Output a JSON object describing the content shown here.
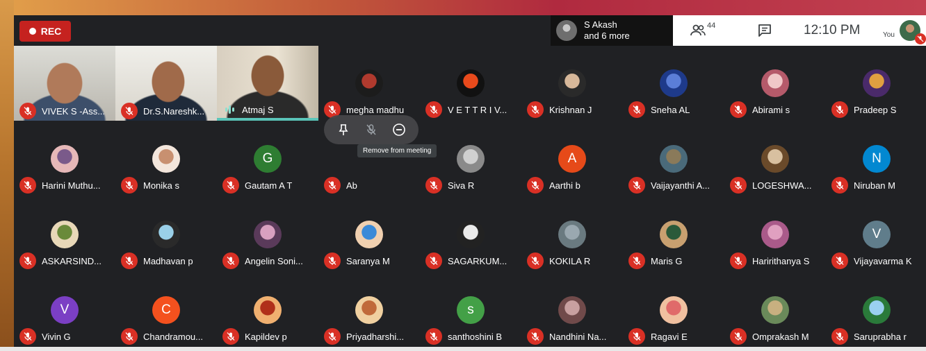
{
  "window": {
    "rec_label": "REC",
    "presenter": {
      "name": "S Akash",
      "more": "and 6 more"
    },
    "people_count": "44",
    "clock": "12:10 PM",
    "you_label": "You"
  },
  "hover": {
    "tooltip": "Remove from meeting"
  },
  "colors": {
    "mic_off": "#d93025",
    "rec": "#c5221f",
    "speaking": "#5ac4b8",
    "meet_bg": "#202124"
  },
  "participants": [
    {
      "name": "VIVEK S -Ass...",
      "muted": true,
      "video": true
    },
    {
      "name": "Dr.S.Nareshk...",
      "muted": true,
      "video": true
    },
    {
      "name": "Atmaj S",
      "muted": false,
      "speaking": true,
      "video": true
    },
    {
      "name": "megha madhu",
      "muted": true
    },
    {
      "name": "V E T T R I V...",
      "muted": true
    },
    {
      "name": "Krishnan J",
      "muted": true
    },
    {
      "name": "Sneha AL",
      "muted": true
    },
    {
      "name": "Abirami s",
      "muted": true
    },
    {
      "name": "Pradeep S",
      "muted": true
    },
    {
      "name": "Harini Muthu...",
      "muted": true
    },
    {
      "name": "Monika s",
      "muted": true
    },
    {
      "name": "Gautam A T",
      "muted": true,
      "letter": "G",
      "color": "#2e7d32"
    },
    {
      "name": "Ab",
      "muted": true
    },
    {
      "name": "Siva R",
      "muted": true
    },
    {
      "name": "Aarthi b",
      "muted": true,
      "letter": "A",
      "color": "#e64a19"
    },
    {
      "name": "Vaijayanthi A...",
      "muted": true
    },
    {
      "name": "LOGESHWA...",
      "muted": true
    },
    {
      "name": "Niruban M",
      "muted": true,
      "letter": "N",
      "color": "#0288d1"
    },
    {
      "name": "ASKARSIND...",
      "muted": true
    },
    {
      "name": "Madhavan p",
      "muted": true
    },
    {
      "name": "Angelin Soni...",
      "muted": true
    },
    {
      "name": "Saranya M",
      "muted": true
    },
    {
      "name": "SAGARKUM...",
      "muted": true
    },
    {
      "name": "KOKILA R",
      "muted": true
    },
    {
      "name": "Maris G",
      "muted": true
    },
    {
      "name": "Haririthanya S",
      "muted": true
    },
    {
      "name": "Vijayavarma K",
      "muted": true,
      "letter": "V",
      "color": "#607d8b"
    },
    {
      "name": "Vivin G",
      "muted": true,
      "letter": "V",
      "color": "#7b3fc4"
    },
    {
      "name": "Chandramou...",
      "muted": true,
      "letter": "C",
      "color": "#f4511e"
    },
    {
      "name": "Kapildev p",
      "muted": true
    },
    {
      "name": "Priyadharshi...",
      "muted": true
    },
    {
      "name": "santhoshini B",
      "muted": true,
      "letter": "s",
      "color": "#43a047"
    },
    {
      "name": "Nandhini Na...",
      "muted": true
    },
    {
      "name": "Ragavi E",
      "muted": true
    },
    {
      "name": "Omprakash M",
      "muted": true
    },
    {
      "name": "Saruprabha r",
      "muted": true
    }
  ]
}
